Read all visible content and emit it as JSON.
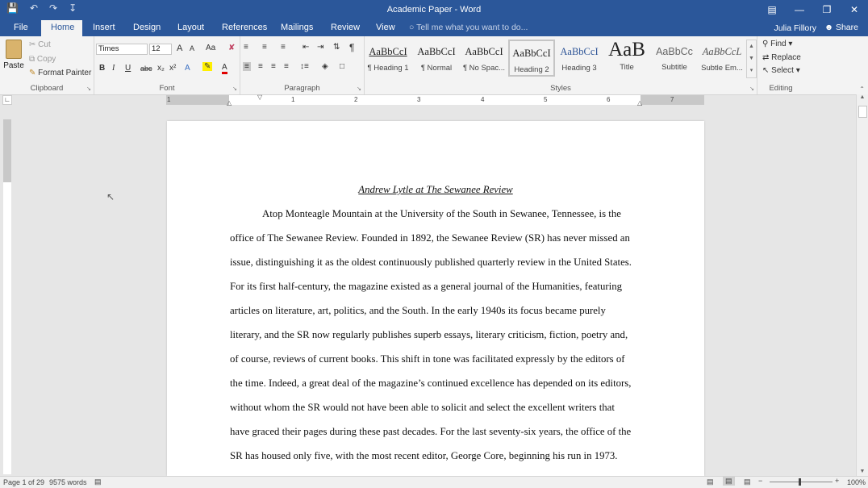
{
  "window": {
    "title": "Academic Paper - Word",
    "user": "Julia Fillory",
    "share": "Share"
  },
  "tabs": [
    "File",
    "Home",
    "Insert",
    "Design",
    "Layout",
    "References",
    "Mailings",
    "Review",
    "View"
  ],
  "tell_me": "Tell me what you want to do...",
  "clipboard": {
    "paste": "Paste",
    "cut": "Cut",
    "copy": "Copy",
    "format_painter": "Format Painter",
    "label": "Clipboard"
  },
  "font": {
    "name": "Times",
    "size": "12",
    "label": "Font",
    "b": "B",
    "i": "I",
    "u": "U",
    "strike": "abc",
    "sub": "x₂",
    "sup": "x²",
    "grow": "A",
    "shrink": "A",
    "case": "Aa"
  },
  "paragraph": {
    "label": "Paragraph"
  },
  "styles": {
    "label": "Styles",
    "items": [
      {
        "preview": "AaBbCcI",
        "name": "¶ Heading 1"
      },
      {
        "preview": "AaBbCcI",
        "name": "¶ Normal"
      },
      {
        "preview": "AaBbCcI",
        "name": "¶ No Spac..."
      },
      {
        "preview": "AaBbCcI",
        "name": "Heading 2"
      },
      {
        "preview": "AaBbCcI",
        "name": "Heading 3"
      },
      {
        "preview": "AaB",
        "name": "Title"
      },
      {
        "preview": "AaBbCc",
        "name": "Subtitle"
      },
      {
        "preview": "AaBbCcL",
        "name": "Subtle Em..."
      }
    ]
  },
  "editing": {
    "find": "Find",
    "replace": "Replace",
    "select": "Select",
    "label": "Editing"
  },
  "ruler": {
    "numbers": [
      "1",
      "1",
      "2",
      "3",
      "4",
      "5",
      "6",
      "7"
    ]
  },
  "document": {
    "heading": "Andrew Lytle at The Sewanee Review",
    "lines": [
      "Atop Monteagle Mountain at the University of the South in Sewanee, Tennessee, is the",
      "office of The Sewanee Review. Founded in 1892, the Sewanee Review (SR) has never missed an",
      "issue, distinguishing it as the oldest continuously published quarterly review in the United States.",
      "For its first half-century, the magazine existed as a general journal of the Humanities, featuring",
      "articles on literature, art, politics, and the South. In the early 1940s its focus became purely",
      "literary, and the SR now regularly publishes superb essays, literary criticism, fiction, poetry and,",
      "of course, reviews of current books. This shift in tone was facilitated expressly by the editors of",
      "the time. Indeed, a great deal of the magazine’s continued excellence has depended on its editors,",
      "without whom the SR would not have been able to solicit and select the excellent writers that",
      "have graced their pages during these past decades. For the last seventy-six years, the office of the",
      "SR has housed only five, with the most recent editor, George Core, beginning his run in 1973."
    ]
  },
  "status": {
    "page": "Page 1 of 29",
    "words": "9575 words",
    "zoom": "100%"
  }
}
